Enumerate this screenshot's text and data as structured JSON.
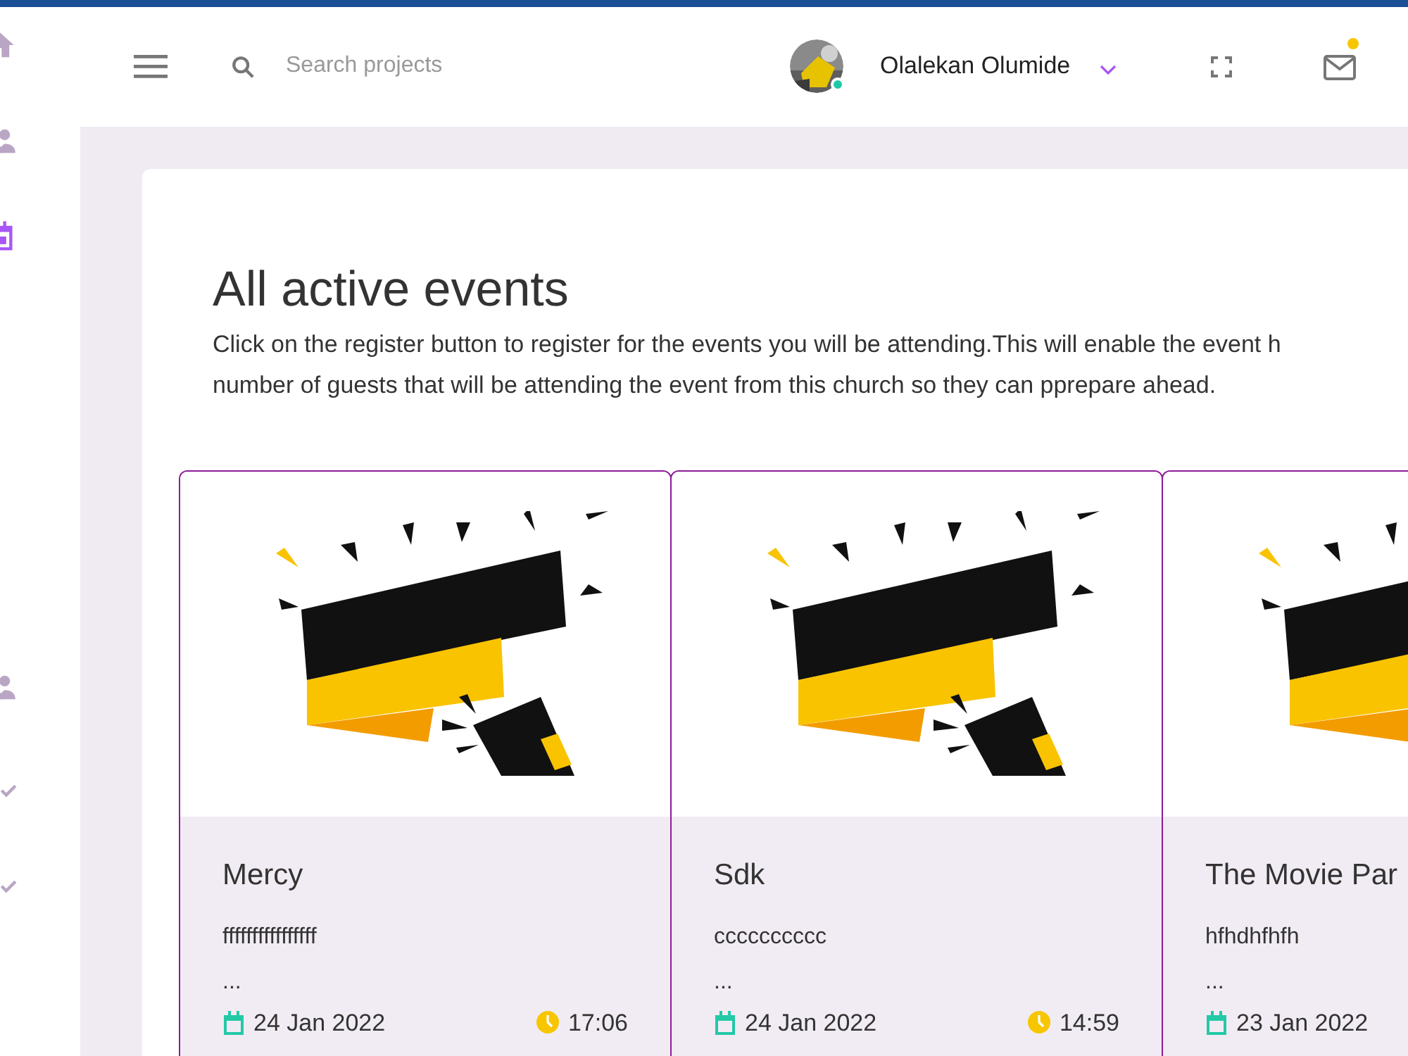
{
  "sidebar": {
    "items": [
      {
        "selected": false
      },
      {
        "selected": false
      },
      {
        "selected": true
      },
      {
        "selected": false
      },
      {
        "selected": false
      },
      {
        "selected": false
      }
    ]
  },
  "header": {
    "search": {
      "placeholder": "Search projects"
    },
    "user": {
      "name": "Olalekan Olumide",
      "online": true
    },
    "mail": {
      "has_notification": true
    }
  },
  "page": {
    "title": "All active events",
    "intro": [
      "Click on the register button to register for the events you will be attending.This will enable the event h",
      "number of guests that will be attending the event from this church so they can pprepare ahead."
    ]
  },
  "events": [
    {
      "title": "Mercy",
      "description": "ffffffffffffffff",
      "more": "...",
      "date": "24 Jan 2022",
      "time": "17:06"
    },
    {
      "title": "Sdk",
      "description": "cccccccccc",
      "more": "...",
      "date": "24 Jan 2022",
      "time": "14:59"
    },
    {
      "title": "The Movie Par",
      "description": "hfhdhfhfh",
      "more": "...",
      "date": "23 Jan 2022"
    }
  ]
}
